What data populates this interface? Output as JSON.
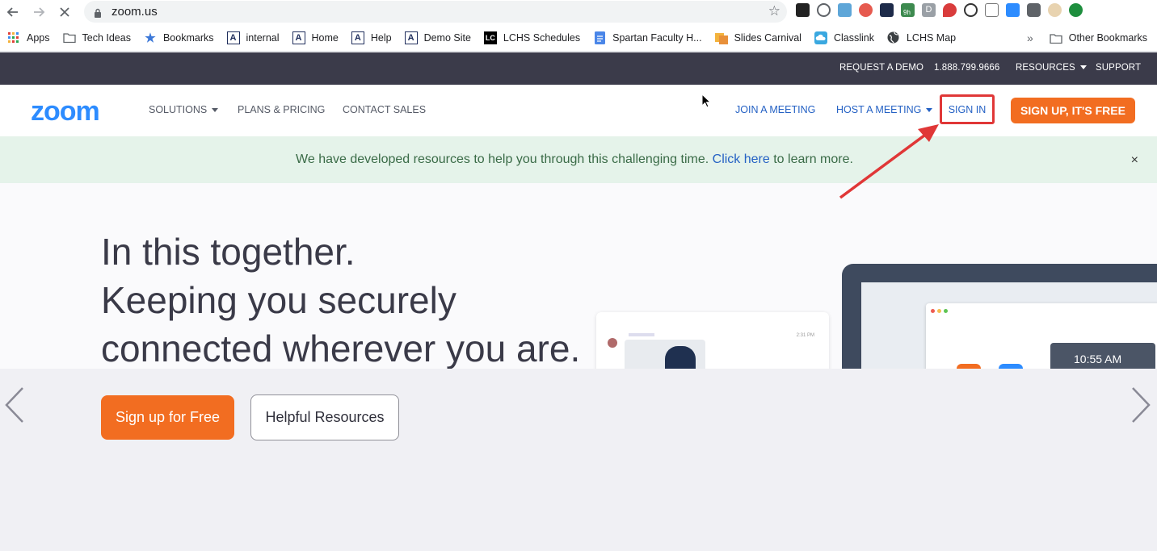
{
  "browser": {
    "url": "zoom.us",
    "bookmarks": [
      {
        "label": "Apps",
        "icon": "apps-grid-icon"
      },
      {
        "label": "Tech Ideas",
        "icon": "folder-icon"
      },
      {
        "label": "Bookmarks",
        "icon": "star-icon"
      },
      {
        "label": "internal",
        "icon": "a-logo-icon"
      },
      {
        "label": "Home",
        "icon": "a-logo-icon"
      },
      {
        "label": "Help",
        "icon": "a-logo-icon"
      },
      {
        "label": "Demo Site",
        "icon": "a-logo-icon"
      },
      {
        "label": "LCHS Schedules",
        "icon": "lc-logo-icon"
      },
      {
        "label": "Spartan Faculty H...",
        "icon": "doc-icon"
      },
      {
        "label": "Slides Carnival",
        "icon": "slides-icon"
      },
      {
        "label": "Classlink",
        "icon": "cloud-icon"
      },
      {
        "label": "LCHS Map",
        "icon": "globe-icon"
      }
    ],
    "more_bookmarks": "»",
    "other_bookmarks": "Other Bookmarks",
    "extension_badge": "9h"
  },
  "topbar": {
    "request_demo": "REQUEST A DEMO",
    "phone": "1.888.799.9666",
    "resources": "RESOURCES",
    "support": "SUPPORT"
  },
  "nav": {
    "logo": "zoom",
    "solutions": "SOLUTIONS",
    "plans": "PLANS & PRICING",
    "contact": "CONTACT SALES",
    "join": "JOIN A MEETING",
    "host": "HOST A MEETING",
    "signin": "SIGN IN",
    "signup": "SIGN UP, IT'S FREE"
  },
  "notice": {
    "before": "We have developed resources to help you through this challenging time.",
    "link": "Click here",
    "after": "to learn more.",
    "close": "×"
  },
  "hero": {
    "line1": "In this together.",
    "line2": "Keeping you securely",
    "line3": "connected wherever you are.",
    "clock": "10:55 AM",
    "chat_time": "2:31 PM",
    "primary_btn": "Sign up for Free",
    "secondary_btn": "Helpful Resources"
  },
  "colors": {
    "accent_orange": "#f26d21",
    "zoom_blue": "#2d8cff",
    "link_blue": "#2461c4",
    "annotation_red": "#e03737"
  }
}
